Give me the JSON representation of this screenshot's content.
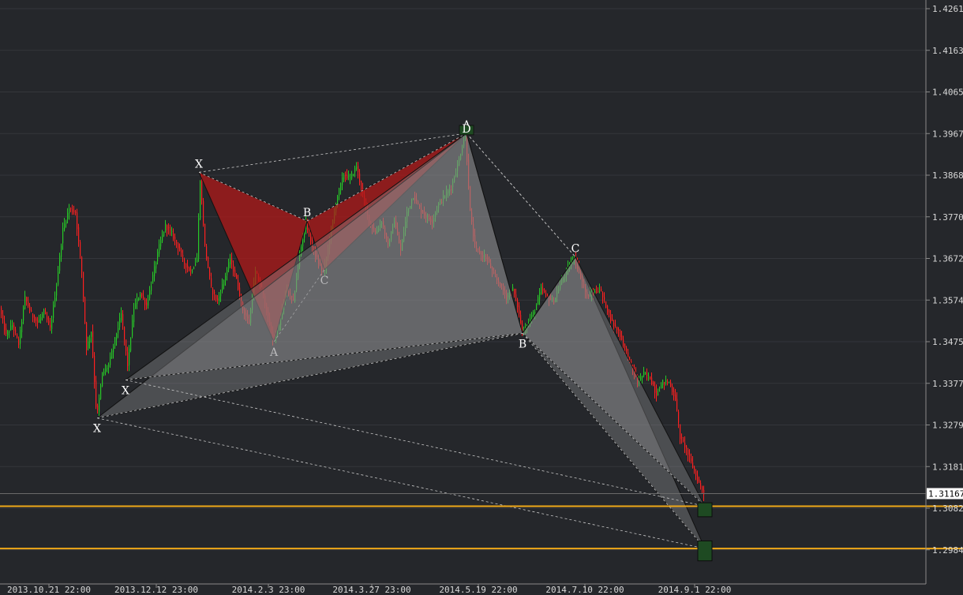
{
  "chart_data": {
    "type": "candlestick",
    "colors": {
      "background": "#25272b",
      "up": "#27c927",
      "down": "#ff2020",
      "grid": "#34363b",
      "bullish_pattern": "#8e8e90",
      "bearish_pattern": "#b01a1a",
      "level_line": "#f0a818",
      "target_box": "#1e4a22"
    },
    "y_ticks": [
      "1.4261",
      "1.4163",
      "1.4065",
      "1.3967",
      "1.3868",
      "1.3770",
      "1.3672",
      "1.3574",
      "1.3475",
      "1.3377",
      "1.3279",
      "1.3181",
      "1.3082",
      "1.2984"
    ],
    "x_ticks": [
      "2013.10.21 22:00",
      "2013.12.12 23:00",
      "2014.2.3 23:00",
      "2014.3.27 23:00",
      "2014.5.19 22:00",
      "2014.7.10 22:00",
      "2014.9.1 22:00"
    ],
    "current_price": "1.31167",
    "level_lines": [
      1.3087,
      1.2987
    ],
    "price_path": [
      [
        0,
        1.3555
      ],
      [
        8,
        1.349
      ],
      [
        16,
        1.3515
      ],
      [
        24,
        1.347
      ],
      [
        32,
        1.358
      ],
      [
        40,
        1.354
      ],
      [
        48,
        1.352
      ],
      [
        56,
        1.3545
      ],
      [
        64,
        1.3505
      ],
      [
        72,
        1.361
      ],
      [
        80,
        1.374
      ],
      [
        88,
        1.379
      ],
      [
        96,
        1.378
      ],
      [
        104,
        1.364
      ],
      [
        110,
        1.346
      ],
      [
        116,
        1.35
      ],
      [
        123,
        1.3295
      ],
      [
        130,
        1.34
      ],
      [
        138,
        1.342
      ],
      [
        146,
        1.348
      ],
      [
        154,
        1.354
      ],
      [
        162,
        1.342
      ],
      [
        170,
        1.3555
      ],
      [
        178,
        1.359
      ],
      [
        186,
        1.356
      ],
      [
        194,
        1.363
      ],
      [
        202,
        1.37
      ],
      [
        210,
        1.375
      ],
      [
        218,
        1.373
      ],
      [
        226,
        1.37
      ],
      [
        234,
        1.366
      ],
      [
        242,
        1.364
      ],
      [
        250,
        1.367
      ],
      [
        254,
        1.386
      ],
      [
        260,
        1.37
      ],
      [
        268,
        1.36
      ],
      [
        276,
        1.357
      ],
      [
        284,
        1.362
      ],
      [
        292,
        1.367
      ],
      [
        300,
        1.362
      ],
      [
        308,
        1.355
      ],
      [
        316,
        1.352
      ],
      [
        324,
        1.364
      ],
      [
        332,
        1.36
      ],
      [
        340,
        1.353
      ],
      [
        347,
        1.3475
      ],
      [
        355,
        1.352
      ],
      [
        363,
        1.36
      ],
      [
        372,
        1.357
      ],
      [
        380,
        1.368
      ],
      [
        388,
        1.376
      ],
      [
        396,
        1.37
      ],
      [
        404,
        1.366
      ],
      [
        411,
        1.364
      ],
      [
        420,
        1.374
      ],
      [
        428,
        1.382
      ],
      [
        436,
        1.387
      ],
      [
        444,
        1.386
      ],
      [
        452,
        1.389
      ],
      [
        460,
        1.382
      ],
      [
        468,
        1.376
      ],
      [
        476,
        1.373
      ],
      [
        484,
        1.376
      ],
      [
        492,
        1.37
      ],
      [
        500,
        1.376
      ],
      [
        508,
        1.369
      ],
      [
        516,
        1.378
      ],
      [
        524,
        1.382
      ],
      [
        532,
        1.379
      ],
      [
        540,
        1.377
      ],
      [
        548,
        1.376
      ],
      [
        556,
        1.38
      ],
      [
        564,
        1.382
      ],
      [
        572,
        1.384
      ],
      [
        580,
        1.389
      ],
      [
        590,
        1.3967
      ],
      [
        596,
        1.378
      ],
      [
        602,
        1.37
      ],
      [
        610,
        1.368
      ],
      [
        618,
        1.367
      ],
      [
        626,
        1.363
      ],
      [
        634,
        1.361
      ],
      [
        642,
        1.358
      ],
      [
        650,
        1.36
      ],
      [
        656,
        1.356
      ],
      [
        662,
        1.3495
      ],
      [
        670,
        1.352
      ],
      [
        678,
        1.355
      ],
      [
        686,
        1.36
      ],
      [
        694,
        1.358
      ],
      [
        702,
        1.357
      ],
      [
        710,
        1.361
      ],
      [
        718,
        1.364
      ],
      [
        728,
        1.3675
      ],
      [
        736,
        1.363
      ],
      [
        744,
        1.358
      ],
      [
        752,
        1.359
      ],
      [
        760,
        1.36
      ],
      [
        768,
        1.356
      ],
      [
        776,
        1.352
      ],
      [
        784,
        1.35
      ],
      [
        792,
        1.346
      ],
      [
        800,
        1.342
      ],
      [
        808,
        1.338
      ],
      [
        816,
        1.34
      ],
      [
        824,
        1.339
      ],
      [
        832,
        1.335
      ],
      [
        840,
        1.338
      ],
      [
        848,
        1.338
      ],
      [
        856,
        1.334
      ],
      [
        862,
        1.325
      ],
      [
        868,
        1.323
      ],
      [
        876,
        1.319
      ],
      [
        884,
        1.315
      ],
      [
        892,
        1.3117
      ]
    ],
    "patterns": [
      {
        "name": "bearish",
        "fill": "#b01a1a",
        "points": {
          "X": [
            252,
            1.3875
          ],
          "A": [
            347,
            1.3475
          ],
          "B": [
            389,
            1.376
          ],
          "C": [
            411,
            1.3645
          ],
          "D": [
            591,
            1.3967
          ]
        },
        "labels": [
          "X",
          "A",
          "B",
          "C",
          "D"
        ]
      },
      {
        "name": "bullish-outer",
        "fill": "#8e8e90",
        "points": {
          "X": [
            123,
            1.3295
          ],
          "A": [
            591,
            1.3967
          ],
          "B": [
            662,
            1.3495
          ],
          "C": [
            729,
            1.3675
          ],
          "D": [
            893,
            1.2987
          ]
        },
        "labels": [
          "X",
          "A",
          "B",
          "C"
        ]
      },
      {
        "name": "bullish-inner",
        "fill": "#8e8e90",
        "points": {
          "X": [
            159,
            1.3385
          ],
          "A": [
            591,
            1.3967
          ],
          "B": [
            662,
            1.3495
          ],
          "C": [
            729,
            1.3675
          ],
          "D": [
            893,
            1.3087
          ]
        },
        "labels": [
          "X"
        ]
      }
    ],
    "dashed_extra": [
      [
        [
          252,
          1.3875
        ],
        [
          591,
          1.3967
        ]
      ],
      [
        [
          123,
          1.3295
        ],
        [
          893,
          1.2987
        ]
      ],
      [
        [
          159,
          1.3385
        ],
        [
          893,
          1.3087
        ]
      ]
    ],
    "target_boxes": [
      {
        "x": 893,
        "from": 1.3095,
        "to": 1.3062
      },
      {
        "x": 893,
        "from": 1.3005,
        "to": 1.2958
      }
    ],
    "d_marker": {
      "x": 591,
      "label": "D"
    }
  }
}
